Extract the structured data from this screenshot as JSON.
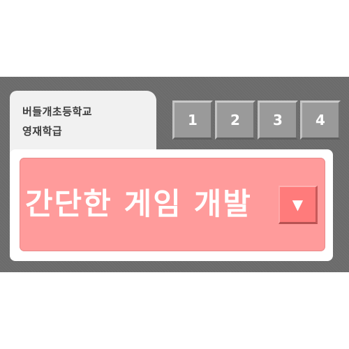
{
  "tab": {
    "line1": "버들개초등학교",
    "line2": "영재학급"
  },
  "pagination": {
    "pages": [
      "1",
      "2",
      "3",
      "4"
    ]
  },
  "project_select": {
    "selected": "간단한 게임 개발",
    "dropdown_icon": "▼"
  },
  "colors": {
    "background_band": "#6b6b6b",
    "tab_background": "#f1f1f1",
    "page_button": "#9a9a9a",
    "select_background": "#ff9b9b",
    "dropdown_button": "#ff7b7b"
  }
}
